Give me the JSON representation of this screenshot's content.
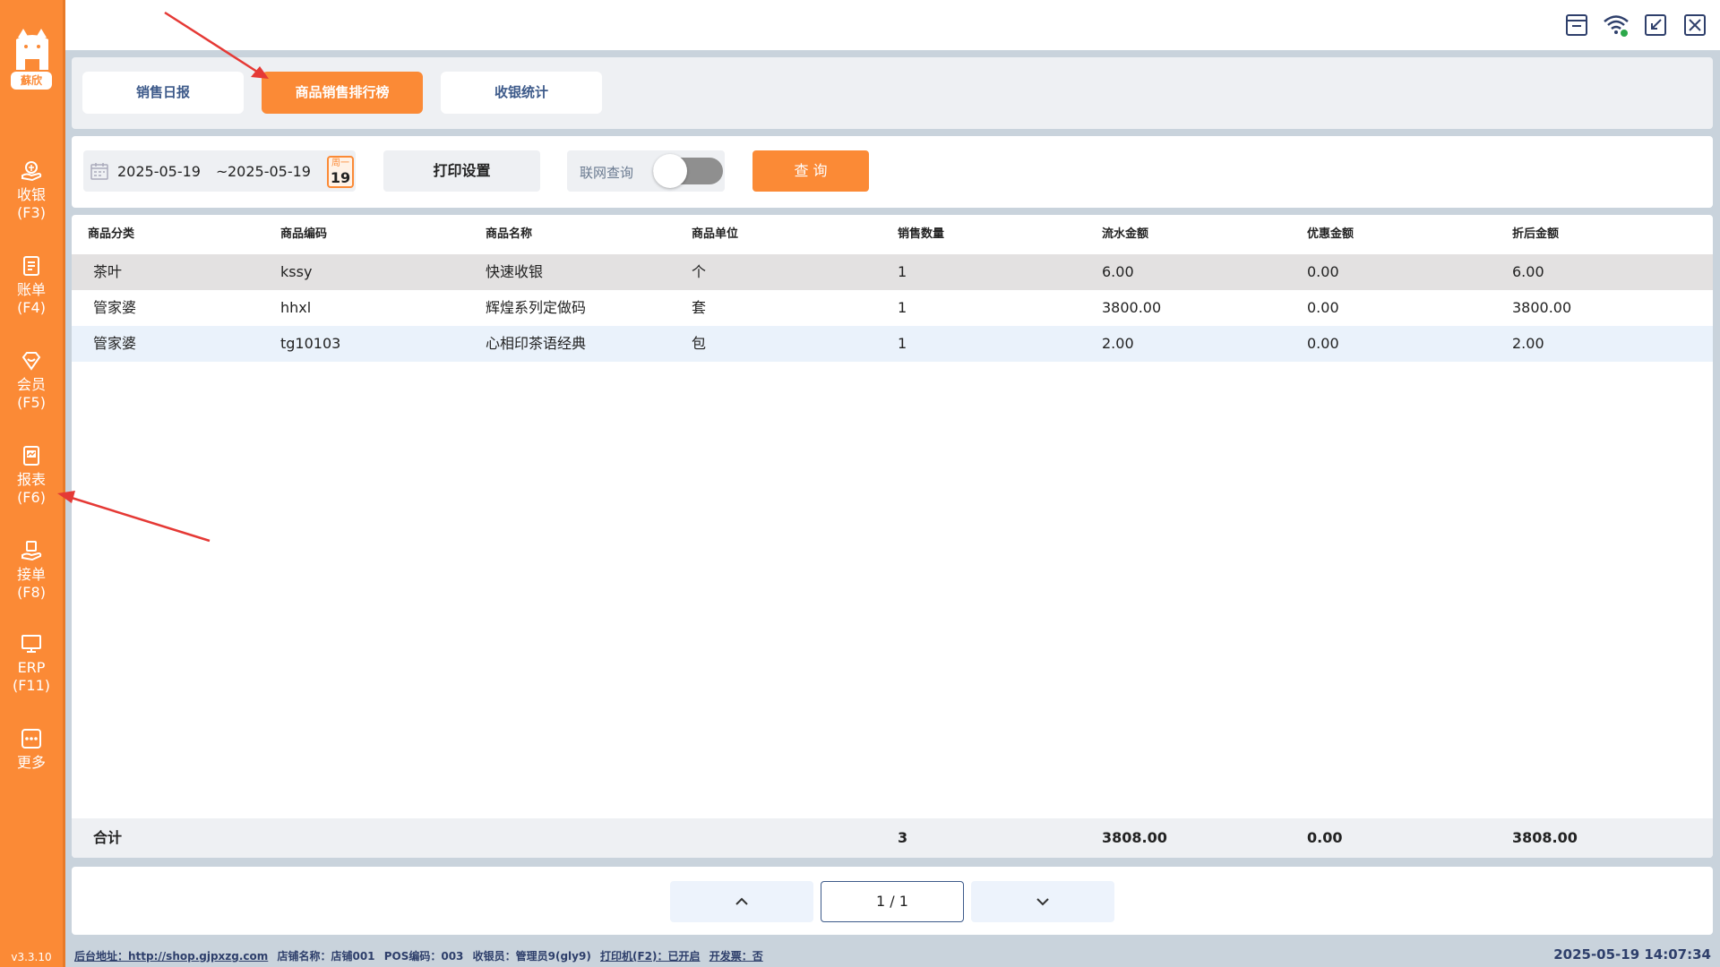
{
  "app": {
    "logo_text": "蘇欣",
    "version": "v3.3.10"
  },
  "sidebar": {
    "items": [
      {
        "label": "收银",
        "key": "(F3)",
        "icon": "cashier-icon"
      },
      {
        "label": "账单",
        "key": "(F4)",
        "icon": "bill-icon"
      },
      {
        "label": "会员",
        "key": "(F5)",
        "icon": "member-icon"
      },
      {
        "label": "报表",
        "key": "(F6)",
        "icon": "report-icon"
      },
      {
        "label": "接单",
        "key": "(F8)",
        "icon": "order-icon"
      },
      {
        "label": "ERP",
        "key": "(F11)",
        "icon": "erp-icon"
      },
      {
        "label": "更多",
        "key": "",
        "icon": "more-icon"
      }
    ]
  },
  "topbar": {
    "icons": [
      "cash-drawer-icon",
      "wifi-icon",
      "shrink-icon",
      "close-icon"
    ]
  },
  "tabs": [
    {
      "label": "销售日报",
      "active": false
    },
    {
      "label": "商品销售排行榜",
      "active": true
    },
    {
      "label": "收银统计",
      "active": false
    }
  ],
  "filter": {
    "date_start": "2025-05-19",
    "date_sep": "~",
    "date_end": "2025-05-19",
    "weekday": "周一",
    "day": "19",
    "print_label": "打印设置",
    "online_label": "联网查询",
    "online_enabled": false,
    "query_label": "查 询"
  },
  "table": {
    "columns": [
      "商品分类",
      "商品编码",
      "商品名称",
      "商品单位",
      "销售数量",
      "流水金额",
      "优惠金额",
      "折后金额"
    ],
    "rows": [
      [
        "茶叶",
        "kssy",
        "快速收银",
        "个",
        "1",
        "6.00",
        "0.00",
        "6.00"
      ],
      [
        "管家婆",
        "hhxl",
        "辉煌系列定做码",
        "套",
        "1",
        "3800.00",
        "0.00",
        "3800.00"
      ],
      [
        "管家婆",
        "tg10103",
        "心相印茶语经典",
        "包",
        "1",
        "2.00",
        "0.00",
        "2.00"
      ]
    ],
    "total": {
      "label": "合计",
      "qty": "3",
      "amount": "3808.00",
      "discount": "0.00",
      "net": "3808.00"
    }
  },
  "pager": {
    "indicator": "1 / 1"
  },
  "status": {
    "backend": "后台地址：http://shop.gjpxzg.com",
    "store": "店铺名称：店铺001",
    "pos": "POS编码：003",
    "cashier": "收银员：管理员9(gly9)",
    "printer": "打印机(F2)：已开启",
    "invoice": "开发票：否",
    "datetime": "2025-05-19 14:07:34"
  },
  "colors": {
    "accent": "#fb8a36",
    "nav_text": "#3d5a8a",
    "arrow": "#e53935"
  }
}
